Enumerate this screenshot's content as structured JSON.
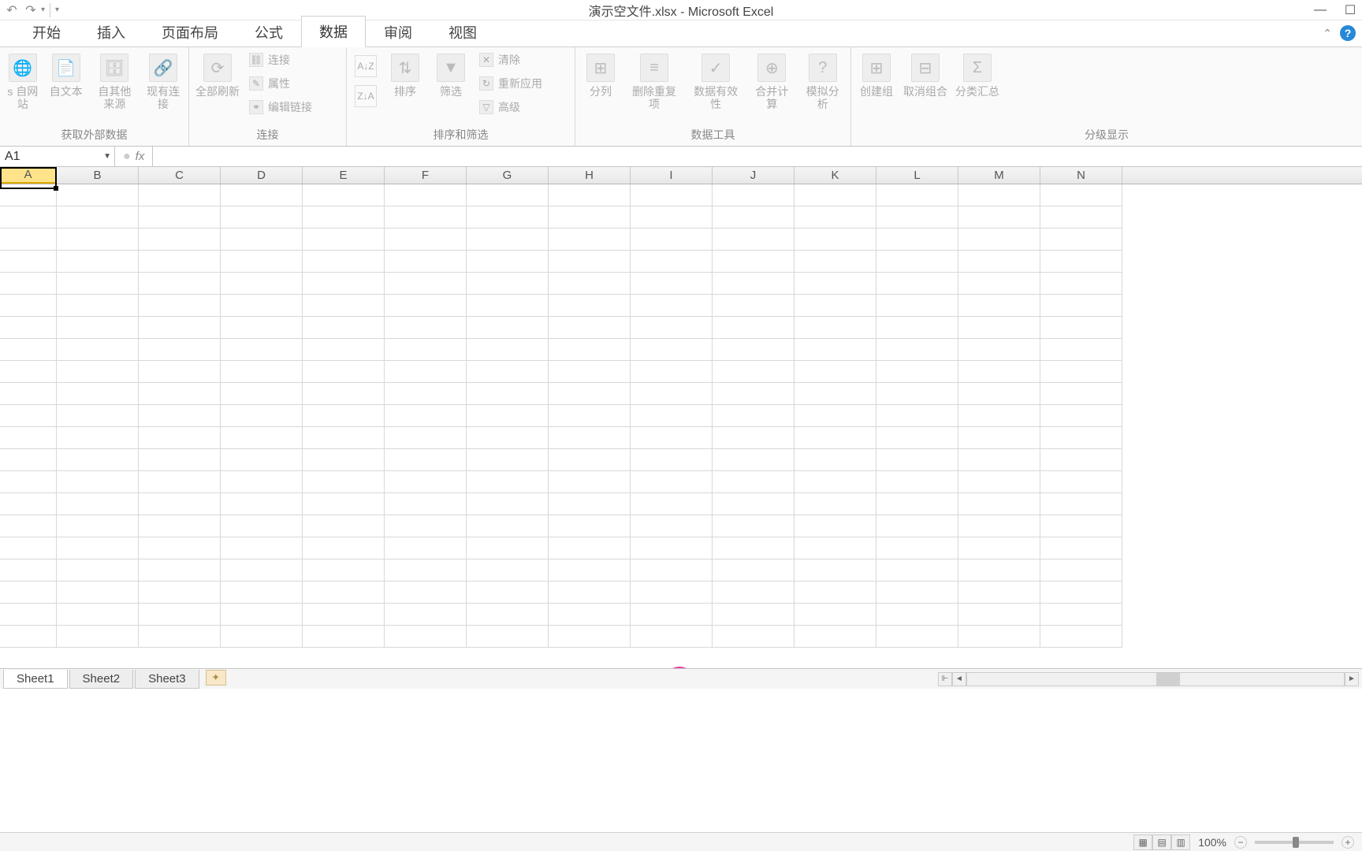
{
  "title": "演示空文件.xlsx - Microsoft Excel",
  "tabs": [
    "开始",
    "插入",
    "页面布局",
    "公式",
    "数据",
    "审阅",
    "视图"
  ],
  "active_tab": "数据",
  "ribbon": {
    "groups": [
      {
        "label": "获取外部数据",
        "items": [
          "自网站",
          "自文本",
          "自其他来源",
          "现有连接"
        ],
        "cut": "s"
      },
      {
        "label": "连接",
        "big": "全部刷新",
        "small": [
          "连接",
          "属性",
          "编辑链接"
        ]
      },
      {
        "label": "排序和筛选",
        "sort": [
          "A→Z",
          "Z→A"
        ],
        "big": [
          "排序",
          "筛选"
        ],
        "small": [
          "清除",
          "重新应用",
          "高级"
        ]
      },
      {
        "label": "数据工具",
        "items": [
          "分列",
          "删除重复项",
          "数据有效性",
          "合并计算",
          "模拟分析"
        ]
      },
      {
        "label": "分级显示",
        "items": [
          "创建组",
          "取消组合",
          "分类汇总"
        ]
      }
    ]
  },
  "name_box": "A1",
  "columns": [
    "A",
    "B",
    "C",
    "D",
    "E",
    "F",
    "G",
    "H",
    "I",
    "J",
    "K",
    "L",
    "M",
    "N"
  ],
  "selected_col": "A",
  "sheets": [
    "Sheet1",
    "Sheet2",
    "Sheet3"
  ],
  "active_sheet": "Sheet1",
  "zoom": "100%"
}
